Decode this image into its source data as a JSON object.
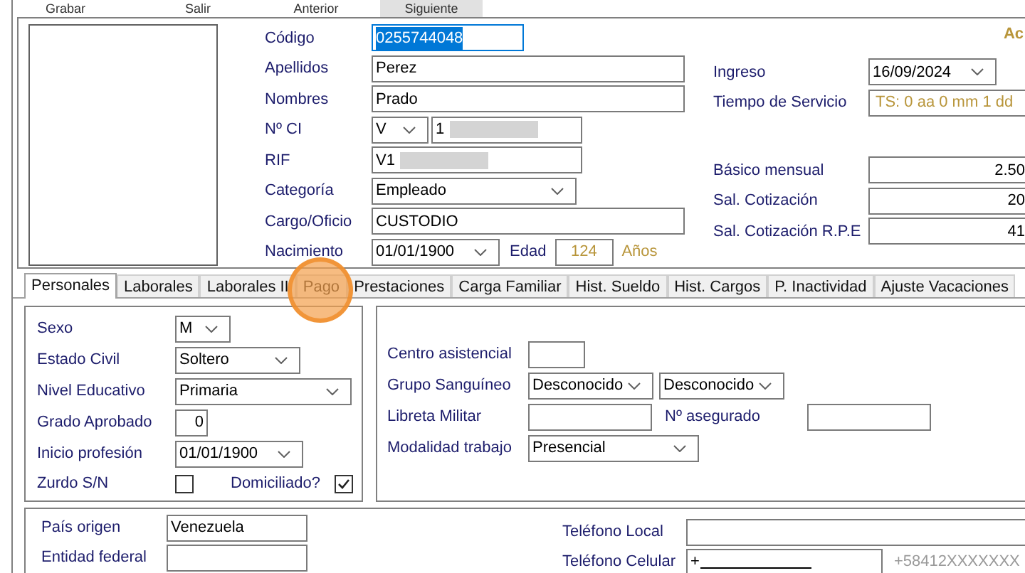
{
  "toolbar": [
    {
      "label": "Grabar",
      "selected": false
    },
    {
      "label": "Salir",
      "selected": false
    },
    {
      "label": "Anterior",
      "selected": false
    },
    {
      "label": "Siguiente",
      "selected": true
    }
  ],
  "identity": [
    {
      "label": "Código",
      "kind": "text",
      "value": "0255744048",
      "text_selected": true
    },
    {
      "label": "Apellidos",
      "kind": "text",
      "value": "Perez",
      "text_selected": false
    },
    {
      "label": "Nombres",
      "kind": "text",
      "value": "Prado",
      "text_selected": false
    },
    {
      "label": "Nº CI",
      "kind": "ci",
      "prefix": "V",
      "value": "1",
      "text_selected": false,
      "redacted": true
    },
    {
      "label": "RIF",
      "kind": "text",
      "value": "V1",
      "text_selected": false,
      "redacted": true
    },
    {
      "label": "Categoría",
      "kind": "combo",
      "value": "Empleado",
      "text_selected": false
    },
    {
      "label": "Cargo/Oficio",
      "kind": "text",
      "value": "CUSTODIO",
      "text_selected": false
    },
    {
      "label": "Nacimiento",
      "kind": "date",
      "value": "01/01/1900",
      "age_label": "Edad",
      "age": "124",
      "age_unit": "Años",
      "text_selected": false
    }
  ],
  "header_link": "Ac",
  "employment": [
    {
      "label": "Ingreso",
      "kind": "date",
      "value": "16/09/2024"
    },
    {
      "label": "Tiempo de Servicio",
      "kind": "readout",
      "value": "TS: 0 aa 0 mm 1 dd"
    },
    {
      "label": "Básico mensual",
      "kind": "amount",
      "value": "2.50"
    },
    {
      "label": "Sal. Cotización",
      "kind": "amount",
      "value": "20"
    },
    {
      "label": "Sal. Cotización R.P.E",
      "kind": "amount",
      "value": "41"
    }
  ],
  "tabs": [
    {
      "label": "Personales",
      "selected": true,
      "pointer": false
    },
    {
      "label": "Laborales",
      "selected": false,
      "pointer": false
    },
    {
      "label": "Laborales II",
      "selected": false,
      "pointer": false
    },
    {
      "label": "Pago",
      "selected": false,
      "pointer": true
    },
    {
      "label": "Prestaciones",
      "selected": false,
      "pointer": false
    },
    {
      "label": "Carga Familiar",
      "selected": false,
      "pointer": false
    },
    {
      "label": "Hist. Sueldo",
      "selected": false,
      "pointer": false
    },
    {
      "label": "Hist. Cargos",
      "selected": false,
      "pointer": false
    },
    {
      "label": "P. Inactividad",
      "selected": false,
      "pointer": false
    },
    {
      "label": "Ajuste Vacaciones",
      "selected": false,
      "pointer": false
    }
  ],
  "personal": [
    {
      "label": "Sexo",
      "kind": "combo",
      "value": "M"
    },
    {
      "label": "Estado Civil",
      "kind": "combo",
      "value": "Soltero"
    },
    {
      "label": "Nivel Educativo",
      "kind": "combo",
      "value": "Primaria"
    },
    {
      "label": "Grado Aprobado",
      "kind": "number",
      "value": "0"
    },
    {
      "label": "Inicio profesión",
      "kind": "date",
      "value": "01/01/1900"
    },
    {
      "label": "Zurdo S/N",
      "kind": "checkbox",
      "checked": false,
      "extra": {
        "label": "Domiciliado?",
        "checked": true
      }
    }
  ],
  "health": [
    {
      "label": "Centro asistencial",
      "kind": "text"
    },
    {
      "label": "Grupo Sanguíneo",
      "kind": "combo_pair",
      "values": [
        "Desconocido",
        "Desconocido"
      ]
    },
    {
      "label": "Libreta Militar",
      "kind": "text",
      "extra": {
        "label": "Nº asegurado"
      }
    },
    {
      "label": "Modalidad trabajo",
      "kind": "combo",
      "value": "Presencial"
    }
  ],
  "origin": [
    {
      "label": "País origen",
      "value": "Venezuela"
    },
    {
      "label": "Entidad federal"
    }
  ],
  "phones": [
    {
      "label": "Teléfono Local"
    },
    {
      "label": "Teléfono Celular",
      "value": "+",
      "example": "+58412XXXXXXX"
    }
  ]
}
